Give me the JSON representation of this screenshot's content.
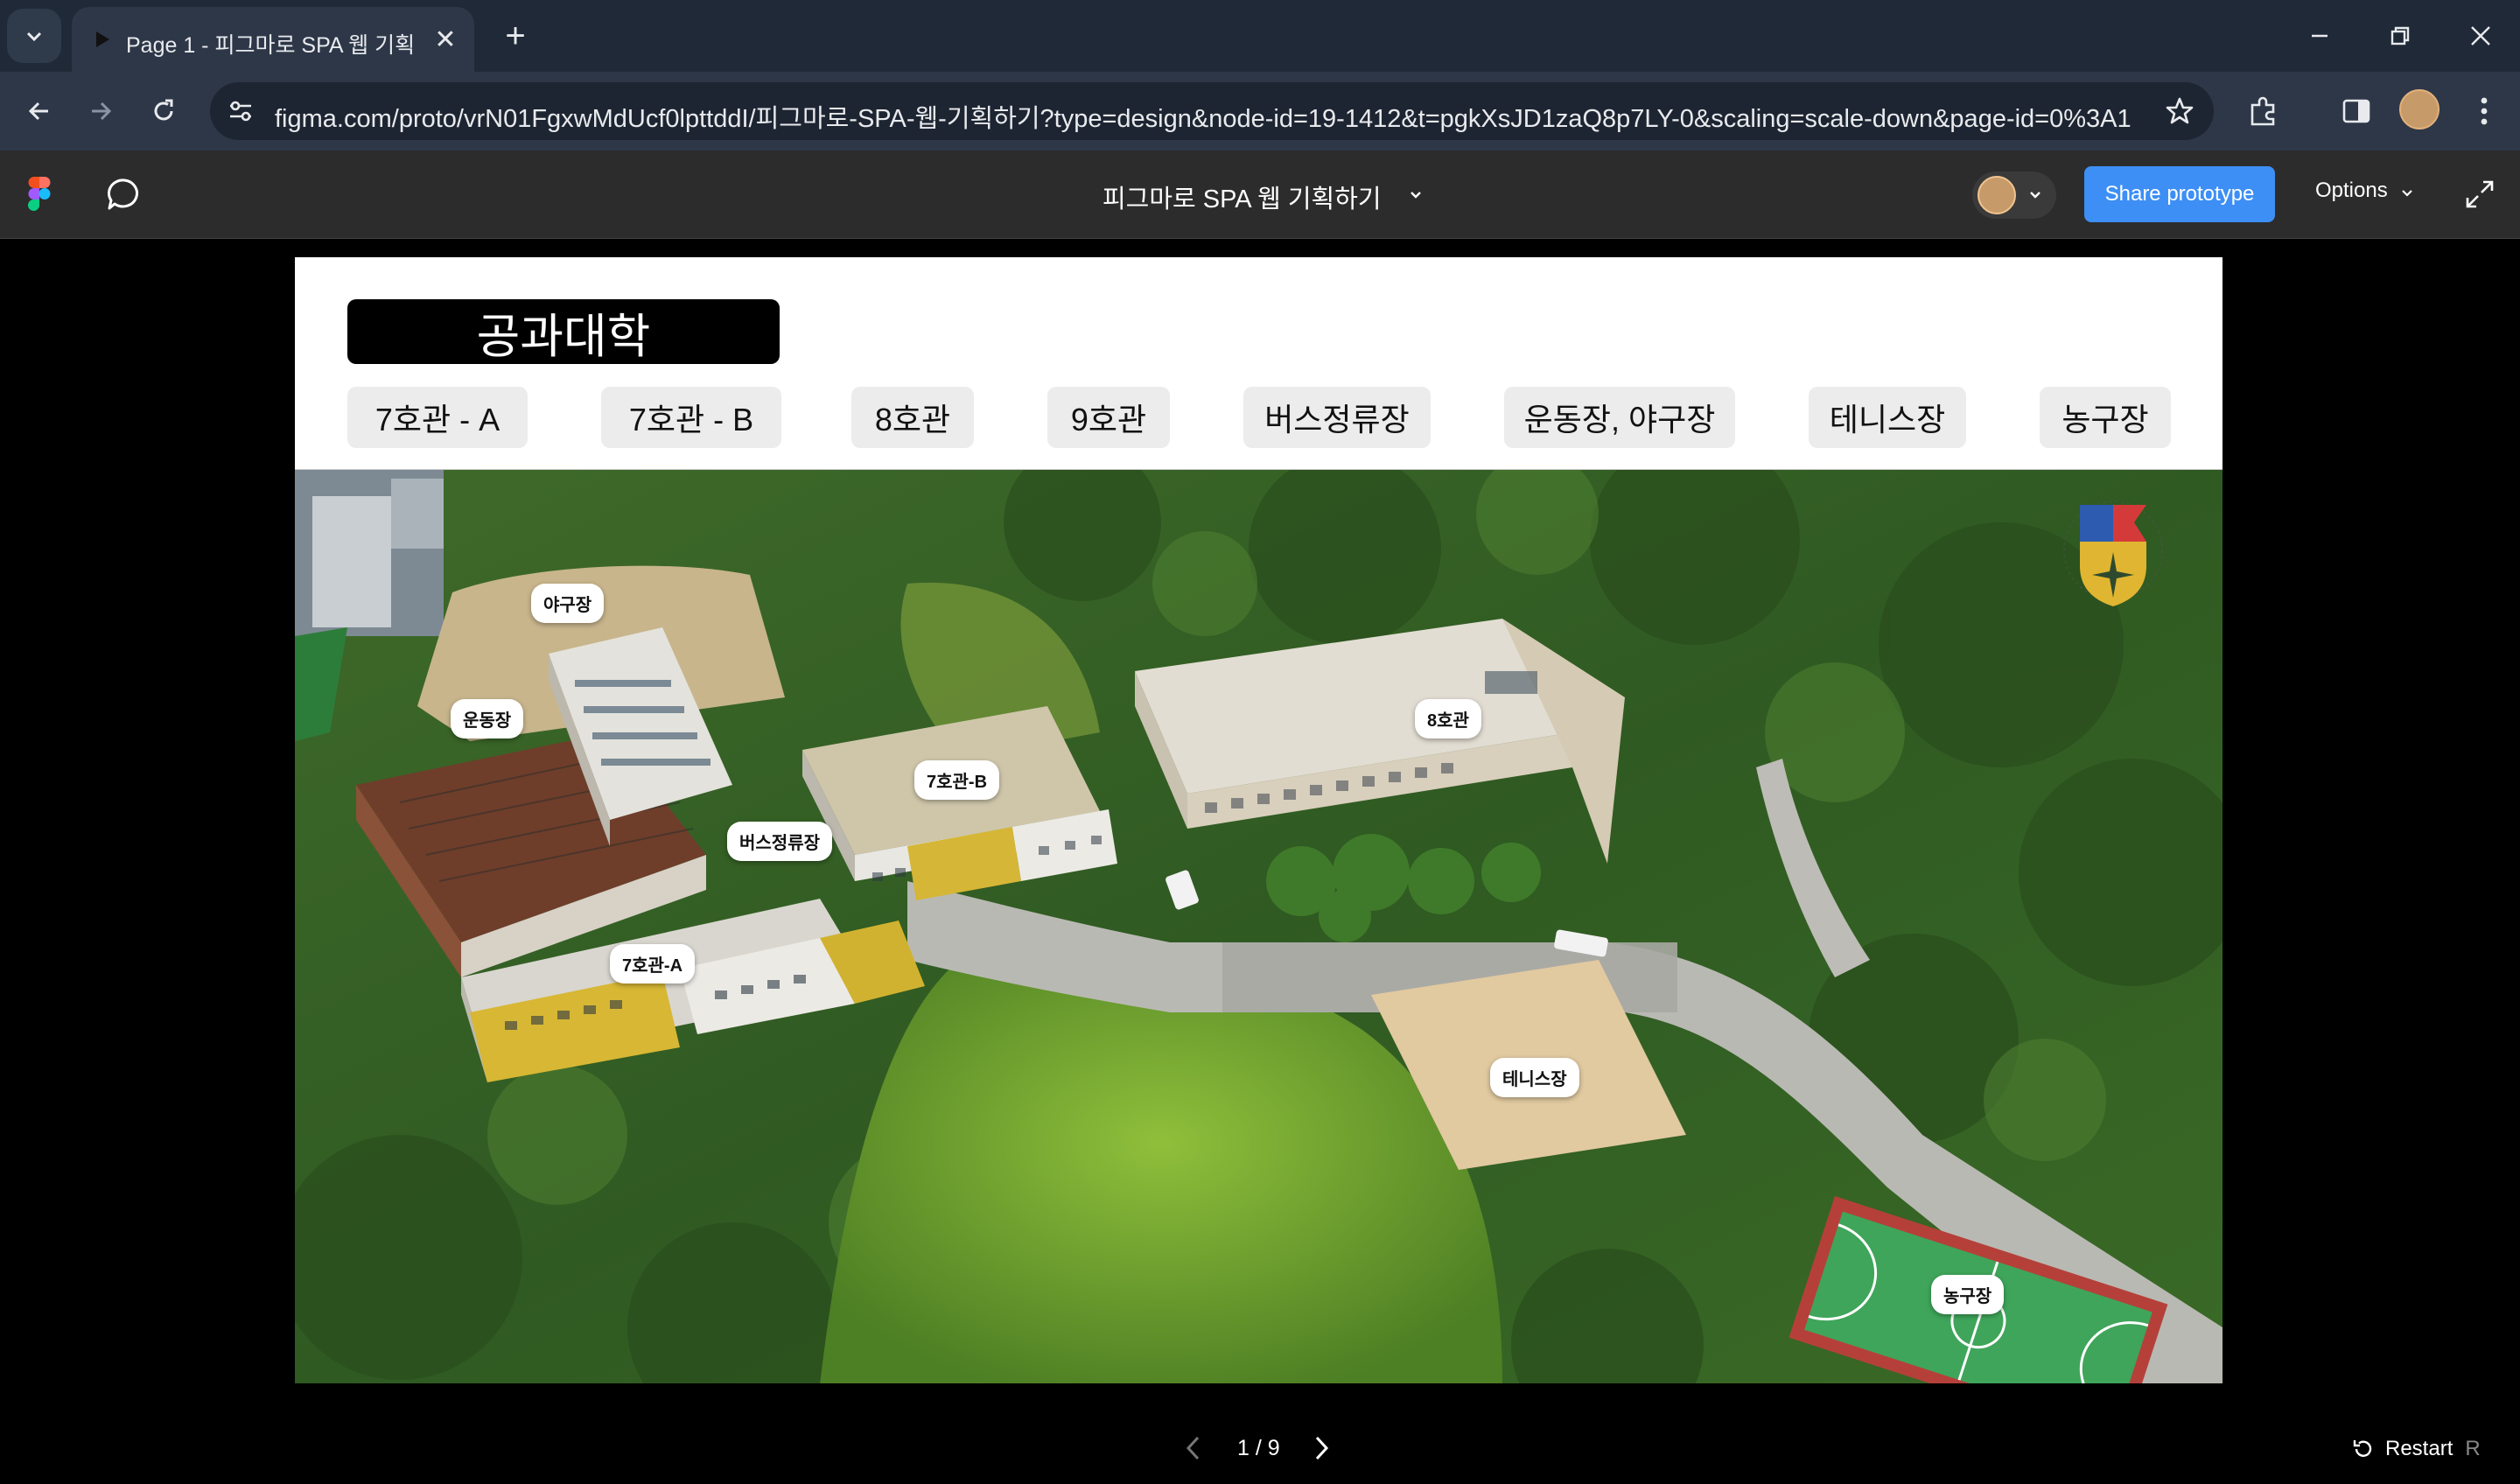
{
  "browser": {
    "tab_title": "Page 1 - 피그마로 SPA 웹 기획하기",
    "url": "figma.com/proto/vrN01FgxwMdUcf0lpttddI/피그마로-SPA-웹-기획하기?type=design&node-id=19-1412&t=pgkXsJD1zaQ8p7LY-0&scaling=scale-down&page-id=0%3A1"
  },
  "figma": {
    "file_title": "피그마로 SPA 웹 기획하기",
    "share_label": "Share prototype",
    "options_label": "Options",
    "accent_color": "#3d8ff5"
  },
  "prototype": {
    "heading": "공과대학",
    "nav": [
      "7호관  - A",
      "7호관  - B",
      "8호관",
      "9호관",
      "버스정류장",
      "운동장, 야구장",
      "테니스장",
      "농구장"
    ],
    "map_labels": {
      "baseball": "야구장",
      "field": "운동장",
      "b7b": "7호관-B",
      "bus": "버스정류장",
      "b8": "8호관",
      "b7a": "7호관-A",
      "tennis": "테니스장",
      "basketball": "농구장"
    }
  },
  "footer": {
    "page_indicator": "1 / 9",
    "restart_label": "Restart",
    "restart_key": "R"
  }
}
